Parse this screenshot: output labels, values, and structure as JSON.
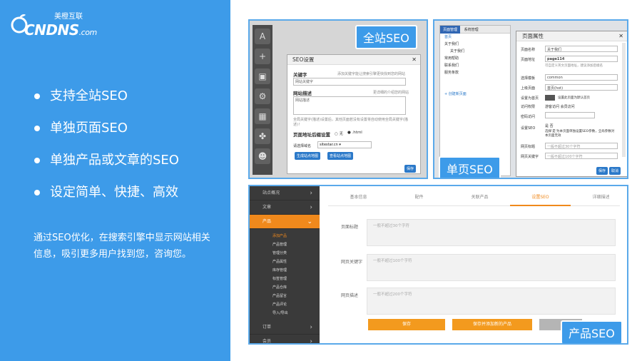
{
  "logo": {
    "cn": "美橙互联",
    "en": "CNDNS",
    "suffix": ".com"
  },
  "features": [
    "支持全站SEO",
    "单独页面SEO",
    "单独产品或文章的SEO",
    "设定简单、快捷、高效"
  ],
  "description": "通过SEO优化，在搜索引擎中显示网站相关信息，吸引更多用户找到您，咨询您。",
  "shot1": {
    "tag": "全站SEO",
    "dialog_title": "SEO设置",
    "keywords_label": "关键字",
    "keywords_hint": "添加关键字能让搜索引擎更快找到您的网站",
    "keywords_value": "网站关键字",
    "desc_label": "网站描述",
    "desc_hint": "更详细的介绍您的网站",
    "desc_value": "网站描述",
    "desc_note": "全局关键字(描述)设置后，其他页面若没有设置将自动使用全局关键字(描述)！",
    "url_label": "页面地址后缀设置",
    "url_opt1": "无",
    "url_opt2": ".html",
    "domain_label": "请选择域名",
    "domain_value": "sitestar.cn",
    "btn_gen": "生成站点地图",
    "btn_view": "查看站点地图",
    "btn_save": "保存"
  },
  "shot2": {
    "tag": "单页SEO",
    "tab1": "页面管理",
    "tab2": "系统管理",
    "tree": [
      "首页",
      "关于我们",
      "关于我们",
      "常用帮助",
      "联系我们",
      "服务条款"
    ],
    "tree_foot": "+ 创建新页面",
    "dialog_title": "页面属性",
    "rows": [
      {
        "label": "页面名称",
        "value": "关于我们"
      },
      {
        "label": "页面地址",
        "value": "page114"
      },
      {
        "label": "选择模板",
        "value": "common"
      },
      {
        "label": "上级页面",
        "value": "首页(hot)"
      },
      {
        "label": "设置为首页",
        "value": "设置此页面为默认首页"
      },
      {
        "label": "访问权限",
        "value": "游客访问  会员访问"
      },
      {
        "label": "密码访问",
        "value": ""
      },
      {
        "label": "设置SEO",
        "value": "是  否"
      },
      {
        "label": "网页标题",
        "value": "一般不超过30个字符"
      },
      {
        "label": "网页关键字",
        "value": "一般不超过100个字符"
      }
    ],
    "url_note": "可自定义英文页面地址，建议添加后缀名",
    "seo_note": "选择'是'为本页面单独设置SEO参数，全局参数对本页面无效",
    "btn_save": "保存",
    "btn_cancel": "取消"
  },
  "shot3": {
    "tag": "产品SEO",
    "menu": [
      "站点概况",
      "文章",
      "产品"
    ],
    "submenu": [
      "添加产品",
      "产品管理",
      "管理分类",
      "产品属性",
      "库存管理",
      "标签管理",
      "产品仓库",
      "产品留言",
      "产品评论",
      "导入/导出"
    ],
    "menu_bottom": [
      "订单",
      "会员"
    ],
    "tabs": [
      "基本信息",
      "配件",
      "关联产品",
      "设置SEO",
      "详细描述"
    ],
    "fields": [
      {
        "label": "页面标题",
        "placeholder": "一般不超过30个字符"
      },
      {
        "label": "网页关键字",
        "placeholder": "一般不超过100个字符"
      },
      {
        "label": "网页描述",
        "placeholder": "一般不超过200个字符"
      }
    ],
    "btn_save": "保存",
    "btn_save_add": "保存并添加新的产品"
  },
  "colors": {
    "accent": "#3d9be9",
    "orange": "#f39a1e"
  }
}
